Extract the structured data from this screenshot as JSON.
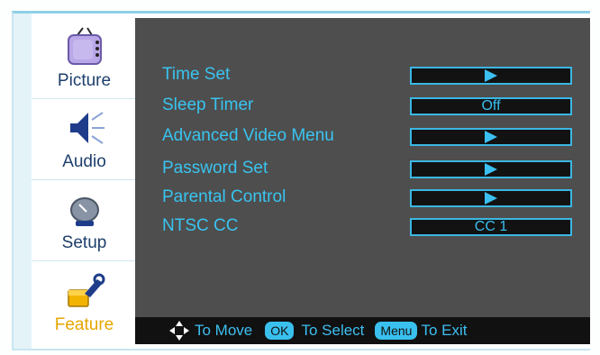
{
  "sidebar": {
    "items": [
      {
        "label": "Picture",
        "icon": "tv-icon",
        "active": false
      },
      {
        "label": "Audio",
        "icon": "speaker-icon",
        "active": false
      },
      {
        "label": "Setup",
        "icon": "satellite-dish-icon",
        "active": false
      },
      {
        "label": "Feature",
        "icon": "tools-icon",
        "active": true
      }
    ]
  },
  "menu": {
    "rows": [
      {
        "label": "Time Set",
        "value": null,
        "kind": "arrow"
      },
      {
        "label": "Sleep Timer",
        "value": "Off",
        "kind": "value"
      },
      {
        "label": "Advanced Video Menu",
        "value": null,
        "kind": "arrow"
      },
      {
        "label": "Password Set",
        "value": null,
        "kind": "arrow"
      },
      {
        "label": "Parental Control",
        "value": null,
        "kind": "arrow"
      },
      {
        "label": "NTSC CC",
        "value": "CC 1",
        "kind": "value"
      }
    ]
  },
  "footer": {
    "move_text": "To Move",
    "ok_key": "OK",
    "select_text": "To Select",
    "menu_key": "Menu",
    "exit_text": "To Exit"
  },
  "colors": {
    "accent": "#39c4f0",
    "panel": "#4e4e4e",
    "active_label": "#e7a600"
  }
}
